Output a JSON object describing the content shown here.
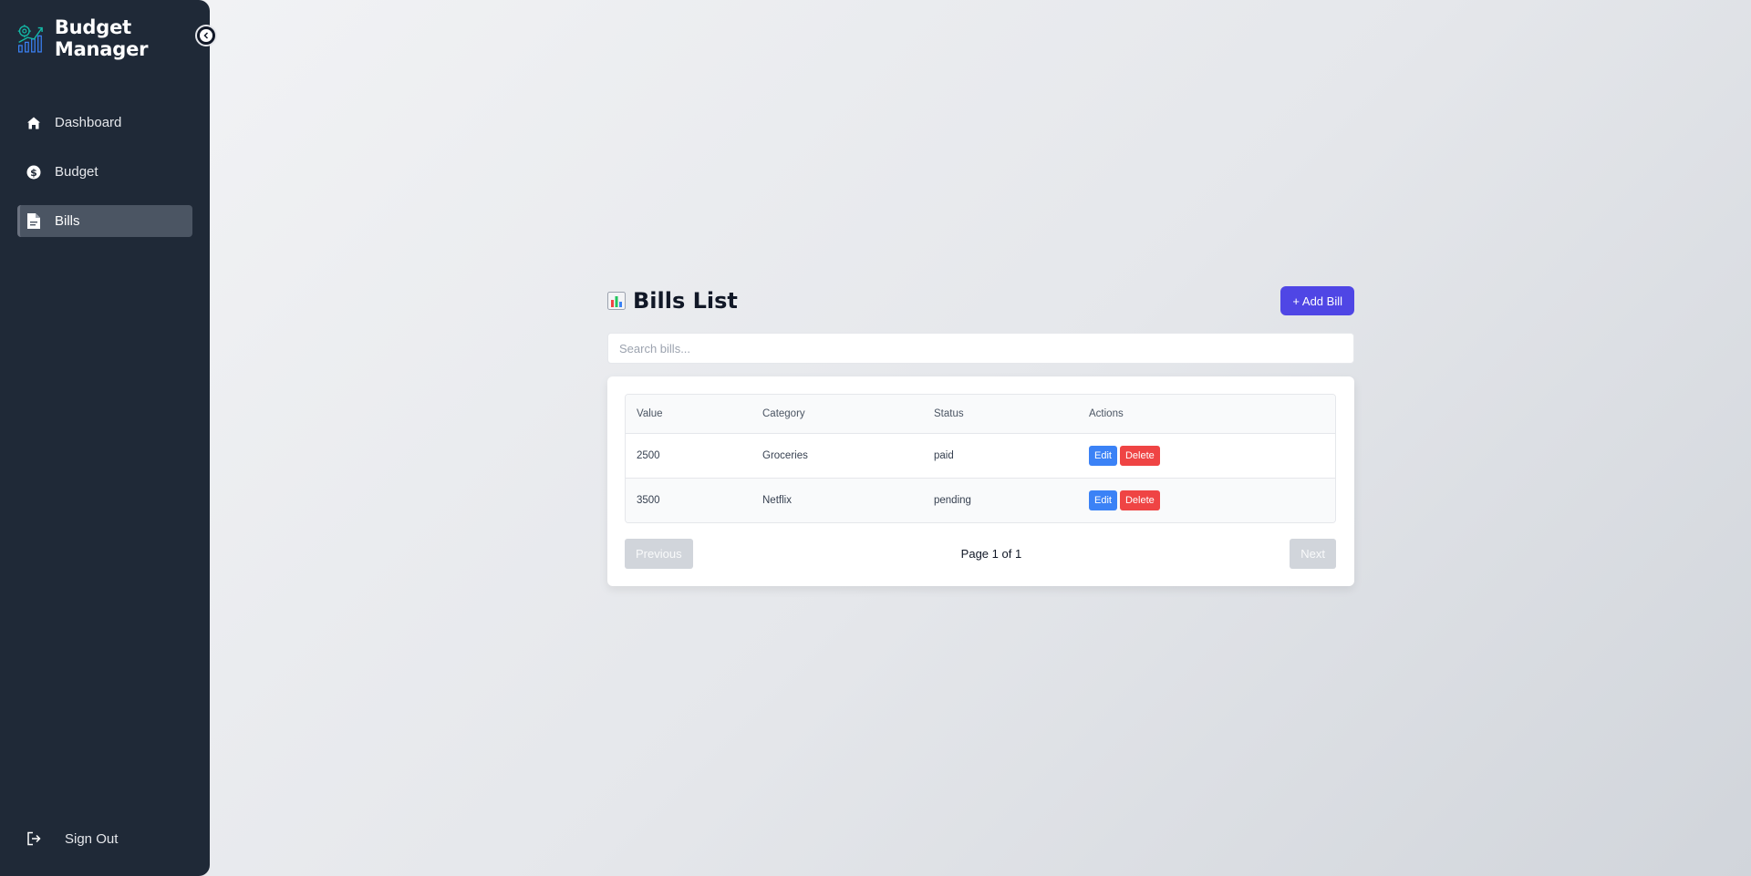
{
  "sidebar": {
    "brand_title": "Budget Manager",
    "items": [
      {
        "label": "Dashboard",
        "icon": "home-icon",
        "active": false
      },
      {
        "label": "Budget",
        "icon": "dollar-circle-icon",
        "active": false
      },
      {
        "label": "Bills",
        "icon": "file-invoice-icon",
        "active": true
      }
    ],
    "sign_out_label": "Sign Out"
  },
  "main": {
    "title_icon": "bar-chart-emoji-icon",
    "title": "Bills List",
    "add_button_label": "+ Add Bill",
    "search_placeholder": "Search bills...",
    "table": {
      "headers": [
        "Value",
        "Category",
        "Status",
        "Actions"
      ],
      "rows": [
        {
          "value": "2500",
          "category": "Groceries",
          "status": "paid",
          "edit_label": "Edit",
          "delete_label": "Delete"
        },
        {
          "value": "3500",
          "category": "Netflix",
          "status": "pending",
          "edit_label": "Edit",
          "delete_label": "Delete"
        }
      ]
    },
    "pagination": {
      "previous_label": "Previous",
      "next_label": "Next",
      "page_info": "Page 1 of 1"
    }
  },
  "colors": {
    "sidebar_bg": "#1f2937",
    "active_item_bg": "#4b5563",
    "primary": "#4f46e5",
    "edit": "#3b82f6",
    "delete": "#ef4444",
    "disabled": "#d1d5db"
  }
}
